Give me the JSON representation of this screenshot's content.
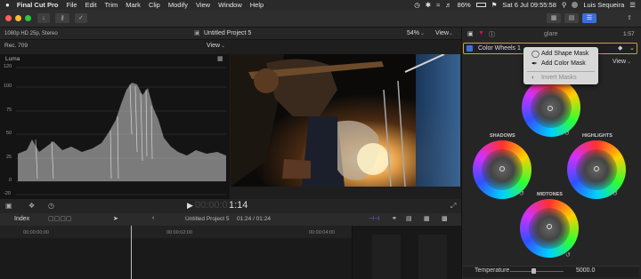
{
  "menubar": {
    "apple": "",
    "app": "Final Cut Pro",
    "items": [
      "File",
      "Edit",
      "Trim",
      "Mark",
      "Clip",
      "Modify",
      "View",
      "Window",
      "Help"
    ],
    "battery": "86%",
    "datetime": "Sat 6 Jul  09:55:58",
    "user": "Luis Sequeira"
  },
  "viewer": {
    "format": "1080p HD 25p, Stereo",
    "project_title": "Untitled Project 5",
    "zoom": "54%",
    "view_label": "View",
    "timecode": "00:00:01:14",
    "timecode_dim": "00:00:0",
    "timecode_bright": "1:14"
  },
  "inspector": {
    "title": "glare",
    "duration": "1:57",
    "effect_name": "Color Wheels 1",
    "view_label": "View",
    "wheels": {
      "shadows": "SHADOWS",
      "highlights": "HIGHLIGHTS",
      "midtones": "MIDTONES"
    },
    "temperature_label": "Temperature",
    "temperature_value": "5000.0"
  },
  "scope": {
    "rec": "Rec. 709",
    "view_label": "View",
    "luma": "Luma",
    "ticks": [
      "120",
      "100",
      "75",
      "50",
      "25",
      "0",
      "-20"
    ]
  },
  "mask_menu": {
    "add_shape": "Add Shape Mask",
    "add_color": "Add Color Mask",
    "invert": "Invert Masks"
  },
  "timeline": {
    "index": "Index",
    "project": "Untitled Project 5",
    "position": "01:24 / 01:24",
    "ruler": [
      "00:00:00:00",
      "00:00:02:00",
      "00:00:04:00"
    ]
  }
}
